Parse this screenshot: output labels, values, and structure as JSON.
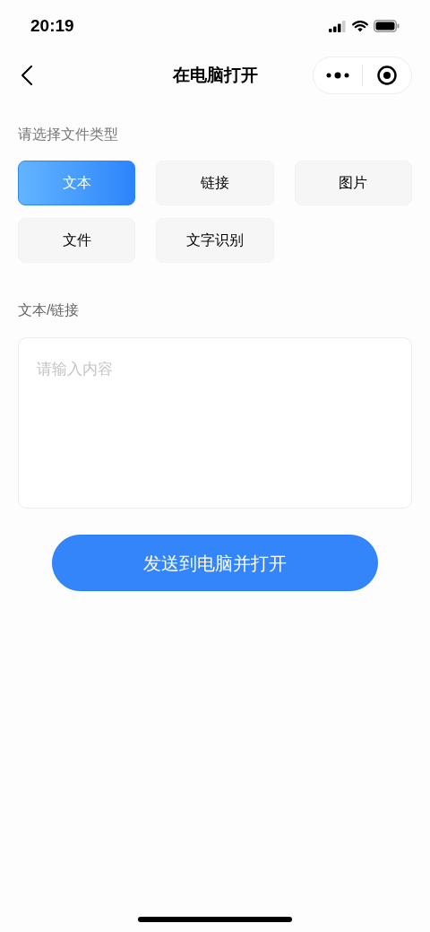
{
  "status_bar": {
    "time": "20:19"
  },
  "nav": {
    "title": "在电脑打开"
  },
  "file_type": {
    "label": "请选择文件类型",
    "options": [
      {
        "label": "文本",
        "selected": true
      },
      {
        "label": "链接",
        "selected": false
      },
      {
        "label": "图片",
        "selected": false
      },
      {
        "label": "文件",
        "selected": false
      },
      {
        "label": "文字识别",
        "selected": false
      }
    ]
  },
  "content": {
    "label": "文本/链接",
    "placeholder": "请输入内容"
  },
  "submit": {
    "label": "发送到电脑并打开"
  }
}
